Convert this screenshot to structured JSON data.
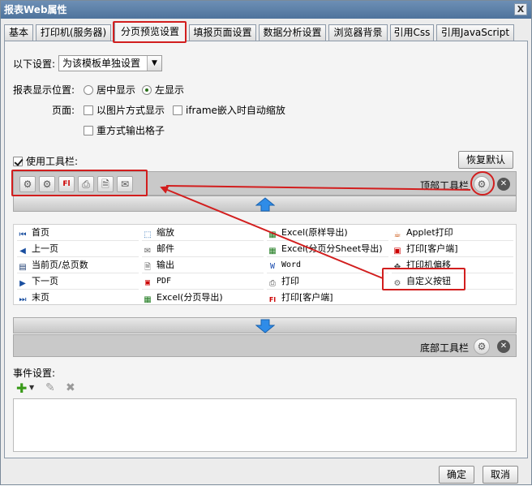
{
  "window": {
    "title": "报表Web属性",
    "close": "X"
  },
  "tabs": [
    {
      "label": "基本"
    },
    {
      "label": "打印机(服务器)"
    },
    {
      "label": "分页预览设置"
    },
    {
      "label": "填报页面设置"
    },
    {
      "label": "数据分析设置"
    },
    {
      "label": "浏览器背景"
    },
    {
      "label": "引用Css"
    },
    {
      "label": "引用JavaScript"
    }
  ],
  "settings": {
    "label": "以下设置:",
    "combo_value": "为该模板单独设置",
    "position_label": "报表显示位置:",
    "center": "居中显示",
    "left": "左显示",
    "page_label": "页面:",
    "image_mode": "以图片方式显示",
    "iframe": "iframe嵌入时自动缩放",
    "repeat": "重方式输出格子"
  },
  "toolbar": {
    "use_label": "使用工具栏:",
    "restore": "恢复默认",
    "top_label": "顶部工具栏",
    "bottom_label": "底部工具栏",
    "top_icons": [
      "gear-icon",
      "gear-icon",
      "flash-icon",
      "printer-icon",
      "export-icon",
      "mail-icon"
    ]
  },
  "grid": {
    "col1": [
      "首页",
      "上一页",
      "当前页/总页数",
      "下一页",
      "末页"
    ],
    "col2": [
      "缩放",
      "邮件",
      "输出",
      "PDF",
      "Excel(分页导出)"
    ],
    "col3": [
      "Excel(原样导出)",
      "Excel(分页分Sheet导出)",
      "Word",
      "打印",
      "打印[客户端]"
    ],
    "col4": [
      "Applet打印",
      "打印[客户端]",
      "打印机偏移",
      "自定义按钮"
    ]
  },
  "events": {
    "label": "事件设置:"
  },
  "footer": {
    "ok": "确定",
    "cancel": "取消"
  },
  "colors": {
    "highlight": "#d21e1e",
    "titlebar": "#5a7ea8",
    "arrow_blue": "#2f8ce8"
  }
}
